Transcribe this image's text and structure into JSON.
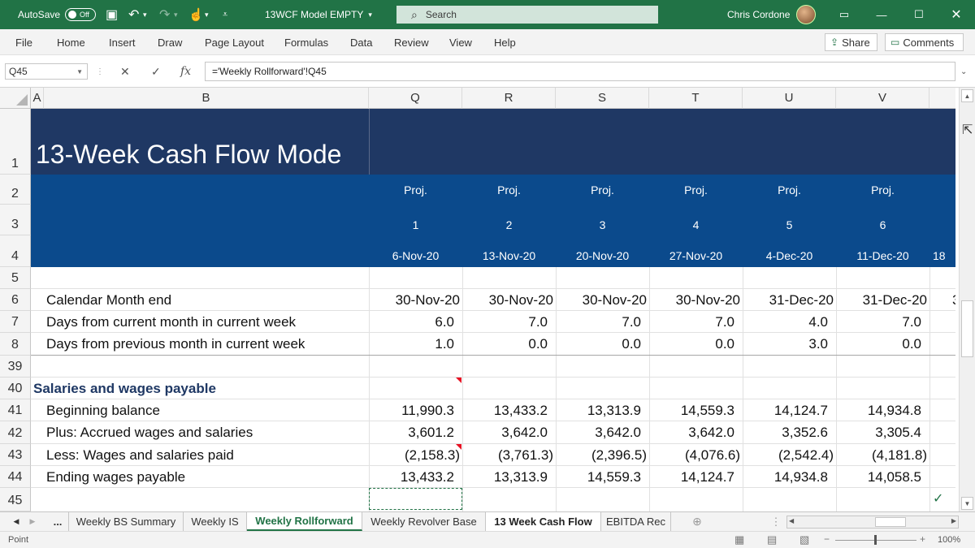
{
  "titlebar": {
    "autosave_label": "AutoSave",
    "autosave_state": "Off",
    "filename": "13WCF Model EMPTY",
    "search_placeholder": "Search",
    "user_name": "Chris Cordone"
  },
  "ribbon": {
    "tabs": [
      "File",
      "Home",
      "Insert",
      "Draw",
      "Page Layout",
      "Formulas",
      "Data",
      "Review",
      "View",
      "Help"
    ],
    "share_label": "Share",
    "comments_label": "Comments"
  },
  "formula_bar": {
    "name_box": "Q45",
    "formula": "='Weekly Rollforward'!Q45"
  },
  "columns": {
    "headers": [
      "A",
      "B",
      "Q",
      "R",
      "S",
      "T",
      "U",
      "V"
    ]
  },
  "sheet": {
    "title": "13-Week Cash Flow Mode",
    "row_numbers": [
      "1",
      "2",
      "3",
      "4",
      "5",
      "6",
      "7",
      "8",
      "39",
      "40",
      "41",
      "42",
      "43",
      "44",
      "45"
    ],
    "proj_label": "Proj.",
    "week_numbers": [
      "1",
      "2",
      "3",
      "4",
      "5",
      "6"
    ],
    "week_dates": [
      "6-Nov-20",
      "13-Nov-20",
      "20-Nov-20",
      "27-Nov-20",
      "4-Dec-20",
      "11-Dec-20"
    ],
    "next_date_partial": "18",
    "month_end_label": "Calendar Month end",
    "month_end": [
      "30-Nov-20",
      "30-Nov-20",
      "30-Nov-20",
      "30-Nov-20",
      "31-Dec-20",
      "31-Dec-20"
    ],
    "month_end_partial": "3",
    "days_current_label": "Days from current month in current week",
    "days_current": [
      "6.0",
      "7.0",
      "7.0",
      "7.0",
      "4.0",
      "7.0"
    ],
    "days_previous_label": "Days from previous month in current week",
    "days_previous": [
      "1.0",
      "0.0",
      "0.0",
      "0.0",
      "3.0",
      "0.0"
    ],
    "section_title": "Salaries and wages payable",
    "beginning_label": "Beginning balance",
    "beginning": [
      "11,990.3",
      "13,433.2",
      "13,313.9",
      "14,559.3",
      "14,124.7",
      "14,934.8"
    ],
    "accrued_label": "Plus: Accrued wages and salaries",
    "accrued": [
      "3,601.2",
      "3,642.0",
      "3,642.0",
      "3,642.0",
      "3,352.6",
      "3,305.4"
    ],
    "paid_label": "Less: Wages and salaries paid",
    "paid": [
      "(2,158.3)",
      "(3,761.3)",
      "(2,396.5)",
      "(4,076.6)",
      "(2,542.4)",
      "(4,181.8)"
    ],
    "ending_label": "Ending wages payable",
    "ending": [
      "13,433.2",
      "13,313.9",
      "14,559.3",
      "14,124.7",
      "14,934.8",
      "14,058.5"
    ]
  },
  "sheet_tabs": {
    "ellipsis": "...",
    "items": [
      "Weekly BS Summary",
      "Weekly IS",
      "Weekly Rollforward",
      "Weekly Revolver Base",
      "13 Week Cash Flow",
      "EBITDA Rec"
    ],
    "active": "Weekly Rollforward"
  },
  "statusbar": {
    "mode": "Point",
    "zoom": "100%"
  },
  "colors": {
    "excel_green": "#217346",
    "title_band": "#1f3864",
    "header_band": "#0b4a8c",
    "section_title": "#1f3864"
  }
}
